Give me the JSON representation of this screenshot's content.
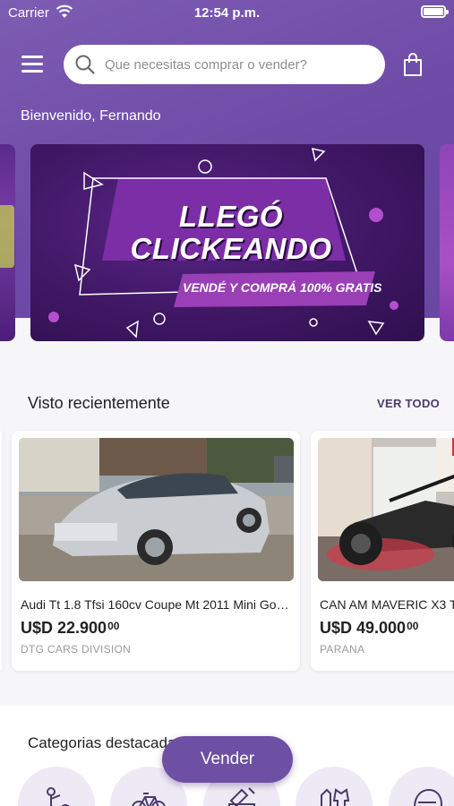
{
  "status_bar": {
    "carrier": "Carrier",
    "time": "12:54 p.m."
  },
  "header": {
    "search_placeholder": "Que necesitas comprar o vender?",
    "welcome": "Bienvenido, Fernando"
  },
  "banner": {
    "title_line1": "LLEGÓ",
    "title_line2": "CLICKEANDO",
    "subtitle": "VENDÉ Y COMPRÁ 100% GRATIS"
  },
  "recent": {
    "title": "Visto recientemente",
    "see_all": "VER TODO",
    "items": [
      {
        "title": "Audi Tt 1.8 Tfsi 160cv Coupe Mt 2011 Mini Gol...",
        "price": "U$D 22.900",
        "cents": "00",
        "seller": "DTG CARS DIVISION",
        "icon": "car-photo"
      },
      {
        "title": "CAN AM MAVERIC X3 T",
        "price": "U$D 49.000",
        "cents": "00",
        "seller": "PARANA",
        "icon": "utv-photo"
      }
    ]
  },
  "categories": {
    "title": "Categorias destacadas",
    "items": [
      "farm-icon",
      "bicycle-icon",
      "tools-icon",
      "clothing-icon",
      "helmet-icon"
    ]
  },
  "sell_button": "Vender",
  "colors": {
    "brand_purple": "#6d4fa3",
    "header_purple": "#7d5cb3"
  }
}
